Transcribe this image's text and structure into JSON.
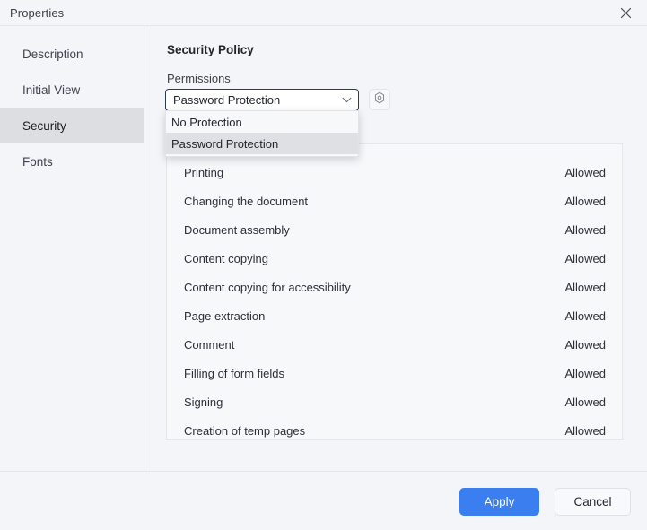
{
  "window": {
    "title": "Properties",
    "close_icon": "close-icon"
  },
  "sidebar": {
    "items": [
      {
        "label": "Description",
        "selected": false
      },
      {
        "label": "Initial View",
        "selected": false
      },
      {
        "label": "Security",
        "selected": true
      },
      {
        "label": "Fonts",
        "selected": false
      }
    ]
  },
  "main": {
    "section_title": "Security Policy",
    "permissions_label": "Permissions",
    "policy_select": {
      "value": "Password Protection",
      "arrow_icon": "chevron-down-icon",
      "expanded": true,
      "options": [
        {
          "label": "No Protection",
          "highlighted": false
        },
        {
          "label": "Password Protection",
          "highlighted": true
        }
      ]
    },
    "settings_button": {
      "icon": "gear-icon"
    },
    "permissions_table": {
      "rows": [
        {
          "name": "Printing",
          "status": "Allowed"
        },
        {
          "name": "Changing the document",
          "status": "Allowed"
        },
        {
          "name": "Document assembly",
          "status": "Allowed"
        },
        {
          "name": "Content copying",
          "status": "Allowed"
        },
        {
          "name": "Content copying for accessibility",
          "status": "Allowed"
        },
        {
          "name": "Page extraction",
          "status": "Allowed"
        },
        {
          "name": "Comment",
          "status": "Allowed"
        },
        {
          "name": "Filling of form fields",
          "status": "Allowed"
        },
        {
          "name": "Signing",
          "status": "Allowed"
        },
        {
          "name": "Creation of temp pages",
          "status": "Allowed"
        }
      ]
    }
  },
  "footer": {
    "apply_label": "Apply",
    "cancel_label": "Cancel"
  },
  "colors": {
    "accent": "#3b7ef0",
    "window_bg": "#f4f5f8",
    "panel_bg": "#f7f8fa",
    "selected_nav": "#dddee1",
    "border": "#e4e6ec",
    "combobox_border": "#2b3a57",
    "text": "#2b2f38"
  }
}
